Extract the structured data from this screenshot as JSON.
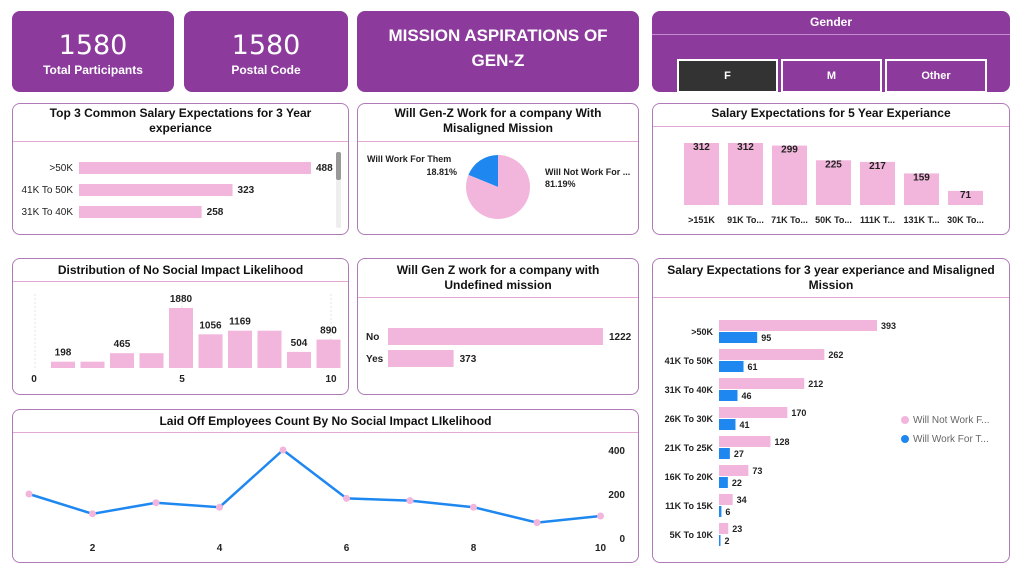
{
  "colors": {
    "purple": "#8c3a9c",
    "pink": "#f2b6dc",
    "blue": "#1e88f0",
    "selected_btn": "#333333"
  },
  "kpis": [
    {
      "value": "1580",
      "label": "Total Participants"
    },
    {
      "value": "1580",
      "label": "Postal Code"
    }
  ],
  "title_banner": "MISSION ASPIRATIONS OF GEN-Z",
  "gender_slicer": {
    "title": "Gender",
    "options": [
      "F",
      "M",
      "Other"
    ],
    "selected": "F"
  },
  "charts": {
    "salary3": {
      "title": "Top 3 Common Salary Expectations for 3 Year experiance",
      "chart_data": {
        "type": "bar",
        "orientation": "horizontal",
        "categories": [
          ">50K",
          "41K To 50K",
          "31K To 40K"
        ],
        "values": [
          488,
          323,
          258
        ]
      }
    },
    "misaligned_pie": {
      "title": "Will Gen-Z Work for a company With Misaligned Mission",
      "chart_data": {
        "type": "pie",
        "slices": [
          {
            "name": "Will Work For Them",
            "value": 18.81,
            "label": "18.81%"
          },
          {
            "name": "Will Not Work For ...",
            "value": 81.19,
            "label": "81.19%"
          }
        ]
      }
    },
    "salary5": {
      "title": "Salary Expectations for 5 Year Experiance",
      "chart_data": {
        "type": "bar",
        "categories": [
          ">151K",
          "91K To...",
          "71K To...",
          "50K To...",
          "111K T...",
          "131K T...",
          "30K To..."
        ],
        "values": [
          312,
          312,
          299,
          225,
          217,
          159,
          71
        ]
      }
    },
    "social_dist": {
      "title": "Distribution of No Social Impact Likelihood",
      "chart_data": {
        "type": "bar",
        "x": [
          1,
          2,
          3,
          4,
          5,
          6,
          7,
          8,
          9,
          10
        ],
        "values": [
          198,
          198,
          465,
          465,
          1880,
          1056,
          1169,
          1169,
          504,
          890
        ],
        "labels": [
          "198",
          "",
          "465",
          "",
          "1880",
          "1056",
          "1169",
          "",
          "504",
          "890"
        ],
        "xticks": [
          "0",
          "5",
          "10"
        ]
      }
    },
    "undefined_mission": {
      "title": "Will Gen Z work for a company with Undefined mission",
      "chart_data": {
        "type": "bar",
        "orientation": "horizontal",
        "categories": [
          "No",
          "Yes"
        ],
        "values": [
          1222,
          373
        ]
      }
    },
    "laid_off": {
      "title": "Laid Off Employees Count By No Social Impact LIkelihood",
      "chart_data": {
        "type": "line",
        "x": [
          1,
          2,
          3,
          4,
          5,
          6,
          7,
          8,
          9,
          10
        ],
        "values": [
          200,
          110,
          160,
          140,
          400,
          180,
          170,
          140,
          70,
          100
        ],
        "xticks": [
          "2",
          "4",
          "6",
          "8",
          "10"
        ],
        "yticks": [
          "400",
          "200",
          "0"
        ],
        "ylim": [
          0,
          400
        ]
      }
    },
    "salary3_misaligned": {
      "title": "Salary Expectations for 3 year experiance and Misaligned Mission",
      "chart_data": {
        "type": "bar",
        "orientation": "horizontal",
        "categories": [
          ">50K",
          "41K To 50K",
          "31K To 40K",
          "26K To 30K",
          "21K To 25K",
          "16K To 20K",
          "11K To 15K",
          "5K To 10K"
        ],
        "series": [
          {
            "name": "Will Not Work F...",
            "values": [
              393,
              262,
              212,
              170,
              128,
              73,
              34,
              23
            ]
          },
          {
            "name": "Will Work For T...",
            "values": [
              95,
              61,
              46,
              41,
              27,
              22,
              6,
              2
            ]
          }
        ],
        "legend": "right"
      }
    }
  }
}
